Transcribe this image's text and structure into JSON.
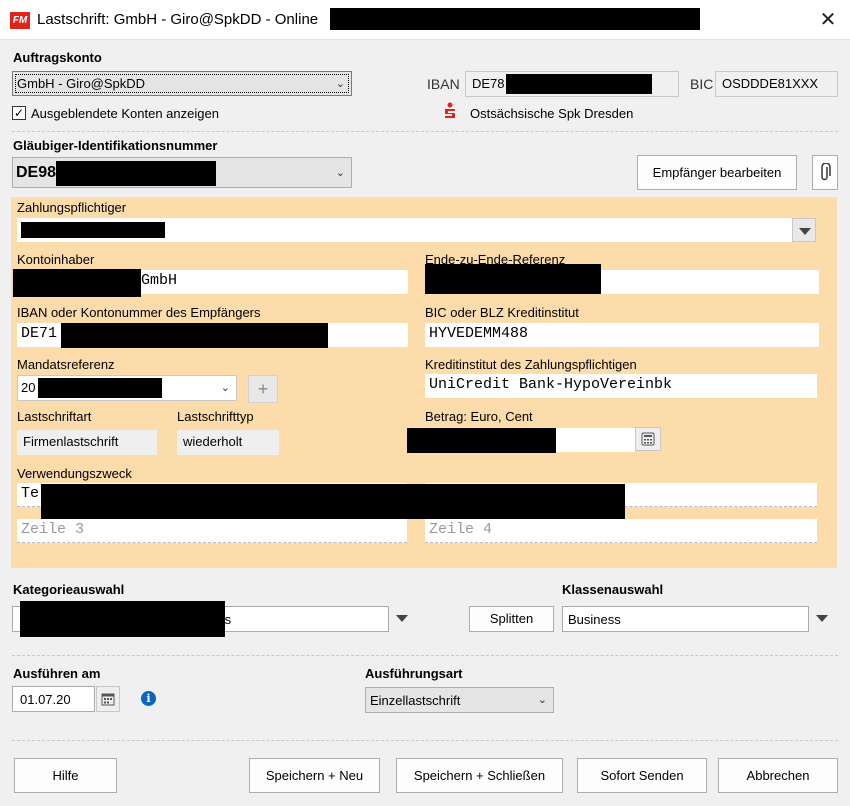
{
  "window": {
    "app_icon": "FM",
    "title": "Lastschrift: GmbH - Giro@SpkDD - Online",
    "close_icon": "close-icon"
  },
  "auftragskonto": {
    "heading": "Auftragskonto",
    "selected": "GmbH - Giro@SpkDD",
    "show_hidden_label": "Ausgeblendete Konten anzeigen",
    "show_hidden_checked": true,
    "iban_label": "IBAN",
    "iban_value": "DE78",
    "bic_label": "BIC",
    "bic_value": "OSDDDE81XXX",
    "bank_name": "Ostsächsische Spk Dresden",
    "bank_icon": "sparkasse-icon"
  },
  "glaeubiger": {
    "heading": "Gläubiger-Identifikationsnummer",
    "value": "DE98",
    "edit_button": "Empfänger bearbeiten",
    "attach_icon": "paperclip-icon"
  },
  "form": {
    "zahlungspflichtiger_label": "Zahlungspflichtiger",
    "zahlungspflichtiger_value": "",
    "kontoinhaber_label": "Kontoinhaber",
    "kontoinhaber_value": "GmbH",
    "e2e_label": "Ende-zu-Ende-Referenz",
    "e2e_value": "",
    "iban_label": "IBAN oder Kontonummer des Empfängers",
    "iban_value": "DE71",
    "bic_label": "BIC oder BLZ Kreditinstitut",
    "bic_value": "HYVEDEMM488",
    "mandat_label": "Mandatsreferenz",
    "mandat_value": "20",
    "plus_label": "+",
    "kreditinstitut_label": "Kreditinstitut des Zahlungspflichtigen",
    "kreditinstitut_value": "UniCredit Bank-HypoVereinbk",
    "lastschriftart_label": "Lastschriftart",
    "lastschriftart_value": "Firmenlastschrift",
    "lastschrifttyp_label": "Lastschrifttyp",
    "lastschrifttyp_value": "wiederholt",
    "betrag_label": "Betrag: Euro, Cent",
    "betrag_value": "",
    "calculator_icon": "calculator-icon",
    "verwendungszweck_label": "Verwendungszweck",
    "zeile1": "Te",
    "zeile2": "",
    "zeile3_placeholder": "Zeile 3",
    "zeile4_placeholder": "Zeile 4"
  },
  "kategorie": {
    "heading": "Kategorieauswahl",
    "value": "ts",
    "split_button": "Splitten",
    "klassen_heading": "Klassenauswahl",
    "klassen_value": "Business"
  },
  "ausfuehren": {
    "heading": "Ausführen am",
    "date": "01.07.20",
    "calendar_icon": "calendar-icon",
    "info_icon": "info-icon",
    "art_heading": "Ausführungsart",
    "art_value": "Einzellastschrift"
  },
  "footer": {
    "hilfe": "Hilfe",
    "speichern_neu": "Speichern + Neu",
    "speichern_schliessen": "Speichern + Schließen",
    "sofort_senden": "Sofort Senden",
    "abbrechen": "Abbrechen"
  }
}
